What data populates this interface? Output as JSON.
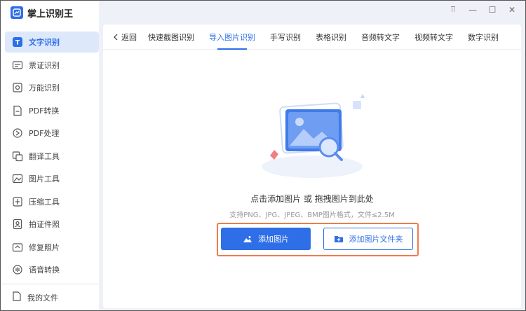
{
  "app": {
    "title": "掌上识别王"
  },
  "window_controls": {
    "pin": "⫪",
    "minimize": "—",
    "maximize": "☐",
    "close": "✕"
  },
  "sidebar": {
    "items": [
      {
        "label": "文字识别",
        "icon": "text-recognition-icon",
        "active": true
      },
      {
        "label": "票证识别",
        "icon": "ticket-icon"
      },
      {
        "label": "万能识别",
        "icon": "universal-scan-icon"
      },
      {
        "label": "PDF转换",
        "icon": "pdf-convert-icon"
      },
      {
        "label": "PDF处理",
        "icon": "pdf-process-icon"
      },
      {
        "label": "翻译工具",
        "icon": "translate-icon"
      },
      {
        "label": "图片工具",
        "icon": "image-tool-icon"
      },
      {
        "label": "压缩工具",
        "icon": "compress-icon"
      },
      {
        "label": "拍证件照",
        "icon": "id-photo-icon"
      },
      {
        "label": "修复照片",
        "icon": "photo-repair-icon"
      },
      {
        "label": "语音转换",
        "icon": "voice-convert-icon"
      }
    ],
    "bottom": {
      "label": "我的文件",
      "icon": "my-files-icon"
    }
  },
  "tabs": {
    "back_label": "返回",
    "items": [
      {
        "label": "快速截图识别"
      },
      {
        "label": "导入图片识别",
        "active": true
      },
      {
        "label": "手写识别"
      },
      {
        "label": "表格识别"
      },
      {
        "label": "音频转文字"
      },
      {
        "label": "视频转文字"
      },
      {
        "label": "数字识别"
      }
    ]
  },
  "upload": {
    "hint": "点击添加图片 或 拖拽图片到此处",
    "formats": "支持PNG、JPG、JPEG、BMP图片格式，文件≤2.5M",
    "add_image_label": "添加图片",
    "add_folder_label": "添加图片文件夹"
  },
  "colors": {
    "accent": "#2e6fe8",
    "highlight_frame": "#ef7b4f"
  }
}
